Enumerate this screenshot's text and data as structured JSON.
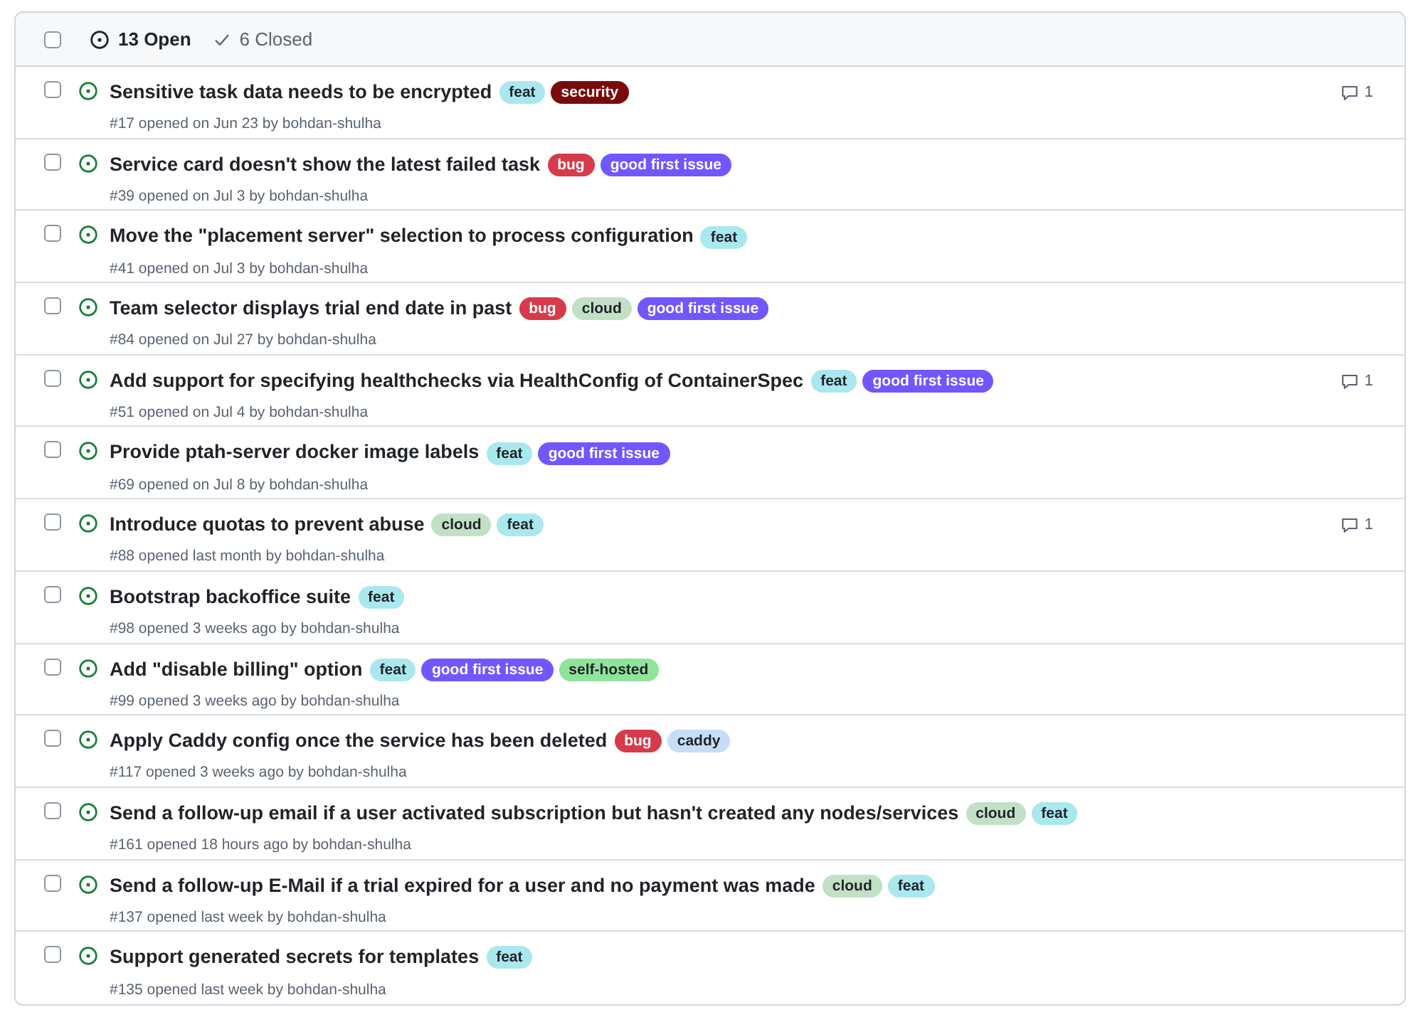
{
  "header": {
    "select_all": {
      "checked": false
    },
    "tabs": [
      {
        "label": "13 Open",
        "selected": true
      },
      {
        "label": "6 Closed",
        "selected": false
      }
    ]
  },
  "issues": [
    {
      "title": "Sensitive task data needs to be encrypted",
      "labels": [
        {
          "name": "feat",
          "color": "#a9e8ee"
        },
        {
          "name": "security",
          "color": "#7a0b0b"
        }
      ],
      "meta": "#17 opened on Jun 23 by bohdan-shulha",
      "comments": "1",
      "checked": false
    },
    {
      "title": "Service card doesn't show the latest failed task",
      "labels": [
        {
          "name": "bug",
          "color": "#d73a4a"
        },
        {
          "name": "good first issue",
          "color": "#7057ff"
        }
      ],
      "meta": "#39 opened on Jul 3 by bohdan-shulha",
      "checked": false
    },
    {
      "title": "Move the \"placement server\" selection to process configuration",
      "labels": [
        {
          "name": "feat",
          "color": "#a9e8ee"
        }
      ],
      "meta": "#41 opened on Jul 3 by bohdan-shulha",
      "checked": false
    },
    {
      "title": "Team selector displays trial end date in past",
      "labels": [
        {
          "name": "bug",
          "color": "#d73a4a"
        },
        {
          "name": "cloud",
          "color": "#c2e0c6"
        },
        {
          "name": "good first issue",
          "color": "#7057ff"
        }
      ],
      "meta": "#84 opened on Jul 27 by bohdan-shulha",
      "checked": false
    },
    {
      "title": "Add support for specifying healthchecks via HealthConfig of ContainerSpec",
      "labels": [
        {
          "name": "feat",
          "color": "#a9e8ee"
        },
        {
          "name": "good first issue",
          "color": "#7057ff"
        }
      ],
      "meta": "#51 opened on Jul 4 by bohdan-shulha",
      "comments": "1",
      "checked": false
    },
    {
      "title": "Provide ptah-server docker image labels",
      "labels": [
        {
          "name": "feat",
          "color": "#a9e8ee"
        },
        {
          "name": "good first issue",
          "color": "#7057ff"
        }
      ],
      "meta": "#69 opened on Jul 8 by bohdan-shulha",
      "checked": false
    },
    {
      "title": "Introduce quotas to prevent abuse",
      "labels": [
        {
          "name": "cloud",
          "color": "#c2e0c6"
        },
        {
          "name": "feat",
          "color": "#a9e8ee"
        }
      ],
      "meta": "#88 opened last month by bohdan-shulha",
      "comments": "1",
      "checked": false
    },
    {
      "title": "Bootstrap backoffice suite",
      "labels": [
        {
          "name": "feat",
          "color": "#a9e8ee"
        }
      ],
      "meta": "#98 opened 3 weeks ago by bohdan-shulha",
      "checked": false
    },
    {
      "title": "Add \"disable billing\" option",
      "labels": [
        {
          "name": "feat",
          "color": "#a9e8ee"
        },
        {
          "name": "good first issue",
          "color": "#7057ff"
        },
        {
          "name": "self-hosted",
          "color": "#8fe39b"
        }
      ],
      "meta": "#99 opened 3 weeks ago by bohdan-shulha",
      "checked": false
    },
    {
      "title": "Apply Caddy config once the service has been deleted",
      "labels": [
        {
          "name": "bug",
          "color": "#d73a4a"
        },
        {
          "name": "caddy",
          "color": "#c5def5"
        }
      ],
      "meta": "#117 opened 3 weeks ago by bohdan-shulha",
      "checked": false
    },
    {
      "title": "Send a follow-up email if a user activated subscription but hasn't created any nodes/services",
      "labels": [
        {
          "name": "cloud",
          "color": "#c2e0c6"
        },
        {
          "name": "feat",
          "color": "#a9e8ee"
        }
      ],
      "meta": "#161 opened 18 hours ago by bohdan-shulha",
      "checked": false
    },
    {
      "title": "Send a follow-up E-Mail if a trial expired for a user and no payment was made",
      "labels": [
        {
          "name": "cloud",
          "color": "#c2e0c6"
        },
        {
          "name": "feat",
          "color": "#a9e8ee"
        }
      ],
      "meta": "#137 opened last week by bohdan-shulha",
      "checked": false
    },
    {
      "title": "Support generated secrets for templates",
      "labels": [
        {
          "name": "feat",
          "color": "#a9e8ee"
        }
      ],
      "meta": "#135 opened last week by bohdan-shulha",
      "checked": false
    }
  ]
}
